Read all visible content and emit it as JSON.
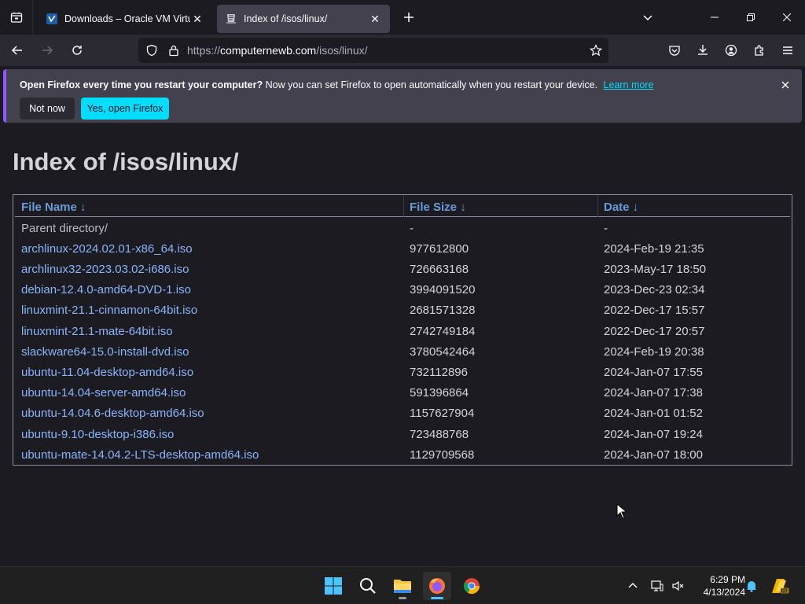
{
  "browser": {
    "tabs": [
      {
        "title": "Downloads – Oracle VM VirtualBox",
        "active": false
      },
      {
        "title": "Index of /isos/linux/",
        "active": true
      }
    ],
    "url": {
      "scheme": "https://",
      "host": "computernewb.com",
      "path": "/isos/linux/"
    }
  },
  "notification": {
    "bold_text": "Open Firefox every time you restart your computer?",
    "text": "Now you can set Firefox to open automatically when you restart your device.",
    "link": "Learn more",
    "btn_not_now": "Not now",
    "btn_yes": "Yes, open Firefox"
  },
  "page": {
    "heading": "Index of /isos/linux/",
    "columns": [
      "File Name ↓",
      "File Size ↓",
      "Date ↓"
    ],
    "rows": [
      {
        "name": "Parent directory/",
        "size": "-",
        "date": "-"
      },
      {
        "name": "archlinux-2024.02.01-x86_64.iso",
        "size": "977612800",
        "date": "2024-Feb-19 21:35"
      },
      {
        "name": "archlinux32-2023.03.02-i686.iso",
        "size": "726663168",
        "date": "2023-May-17 18:50"
      },
      {
        "name": "debian-12.4.0-amd64-DVD-1.iso",
        "size": "3994091520",
        "date": "2023-Dec-23 02:34"
      },
      {
        "name": "linuxmint-21.1-cinnamon-64bit.iso",
        "size": "2681571328",
        "date": "2022-Dec-17 15:57"
      },
      {
        "name": "linuxmint-21.1-mate-64bit.iso",
        "size": "2742749184",
        "date": "2022-Dec-17 20:57"
      },
      {
        "name": "slackware64-15.0-install-dvd.iso",
        "size": "3780542464",
        "date": "2024-Feb-19 20:38"
      },
      {
        "name": "ubuntu-11.04-desktop-amd64.iso",
        "size": "732112896",
        "date": "2024-Jan-07 17:55"
      },
      {
        "name": "ubuntu-14.04-server-amd64.iso",
        "size": "591396864",
        "date": "2024-Jan-07 17:38"
      },
      {
        "name": "ubuntu-14.04.6-desktop-amd64.iso",
        "size": "1157627904",
        "date": "2024-Jan-01 01:52"
      },
      {
        "name": "ubuntu-9.10-desktop-i386.iso",
        "size": "723488768",
        "date": "2024-Jan-07 19:24"
      },
      {
        "name": "ubuntu-mate-14.04.2-LTS-desktop-amd64.iso",
        "size": "1129709568",
        "date": "2024-Jan-07 18:00"
      }
    ]
  },
  "taskbar": {
    "time": "6:29 PM",
    "date": "4/13/2024",
    "apps": [
      "start-icon",
      "search-icon",
      "file-explorer-icon",
      "firefox-icon",
      "chrome-icon"
    ]
  },
  "colors": {
    "link": "#8ab4f8",
    "accent": "#00ddff",
    "notif_border": "#9059ff"
  }
}
